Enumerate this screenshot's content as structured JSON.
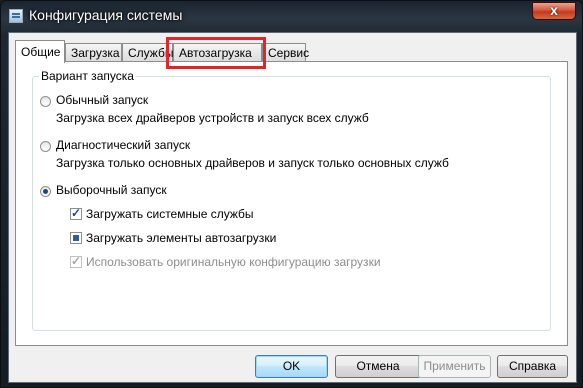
{
  "window": {
    "title": "Конфигурация системы",
    "close_glyph": "x"
  },
  "tabs": [
    {
      "label": "Общие",
      "active": true
    },
    {
      "label": "Загрузка"
    },
    {
      "label": "Службы"
    },
    {
      "label": "Автозагрузка",
      "highlighted": true
    },
    {
      "label": "Сервис"
    }
  ],
  "startup": {
    "group_label": "Вариант запуска",
    "normal": {
      "label": "Обычный запуск",
      "desc": "Загрузка всех драйверов устройств и запуск всех служб",
      "selected": false
    },
    "diagnostic": {
      "label": "Диагностический запуск",
      "desc": "Загрузка только основных драйверов и запуск только основных служб",
      "selected": false
    },
    "selective": {
      "label": "Выборочный запуск",
      "selected": true,
      "options": [
        {
          "label": "Загружать системные службы",
          "state": "checked",
          "enabled": true
        },
        {
          "label": "Загружать элементы автозагрузки",
          "state": "indeterminate",
          "enabled": true
        },
        {
          "label": "Использовать оригинальную конфигурацию загрузки",
          "state": "checked",
          "enabled": false
        }
      ]
    }
  },
  "buttons": {
    "ok": "OK",
    "cancel": "Отмена",
    "apply": "Применить",
    "help": "Справка"
  },
  "colors": {
    "highlight": "#e0262a",
    "accent": "#3c7fb1"
  }
}
